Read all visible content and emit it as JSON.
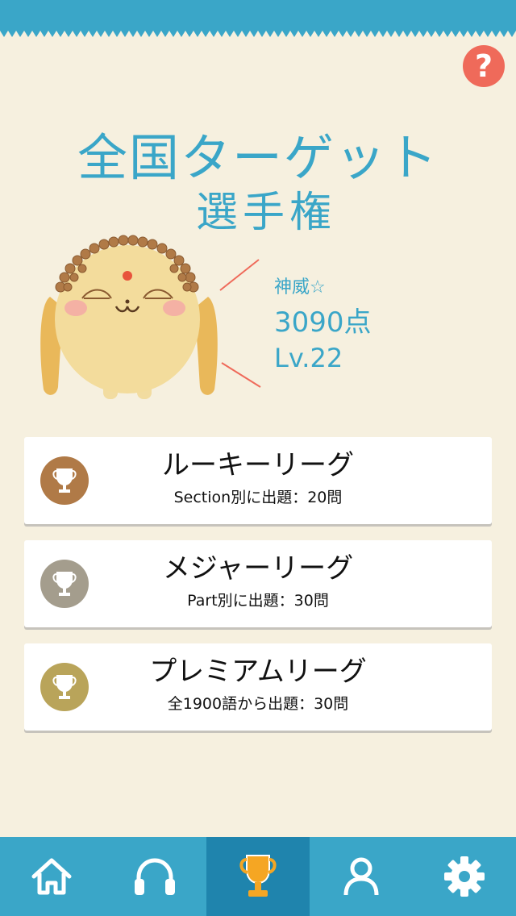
{
  "header": {
    "help_label": "?"
  },
  "title": {
    "line1": "全国ターゲット",
    "line2": "選手権"
  },
  "stats": {
    "rank": "神威☆",
    "score": "3090点",
    "level": "Lv.22"
  },
  "leagues": [
    {
      "name": "ルーキーリーグ",
      "desc": "Section別に出題：20問",
      "medal": "bronze-trophy-icon",
      "color": "#b07a47"
    },
    {
      "name": "メジャーリーグ",
      "desc": "Part別に出題：30問",
      "medal": "silver-trophy-icon",
      "color": "#a49d8d"
    },
    {
      "name": "プレミアムリーグ",
      "desc": "全1900語から出題：30問",
      "medal": "gold-trophy-icon",
      "color": "#b9a45a"
    }
  ],
  "tabbar": {
    "tabs": [
      {
        "icon": "home-icon",
        "active": false
      },
      {
        "icon": "headphones-icon",
        "active": false
      },
      {
        "icon": "trophy-icon",
        "active": true
      },
      {
        "icon": "user-icon",
        "active": false
      },
      {
        "icon": "gear-icon",
        "active": false
      }
    ]
  },
  "colors": {
    "accent": "#3aa6c8",
    "tab_active": "#1f84ad",
    "background": "#f6f0df",
    "help": "#ef6a5a"
  }
}
